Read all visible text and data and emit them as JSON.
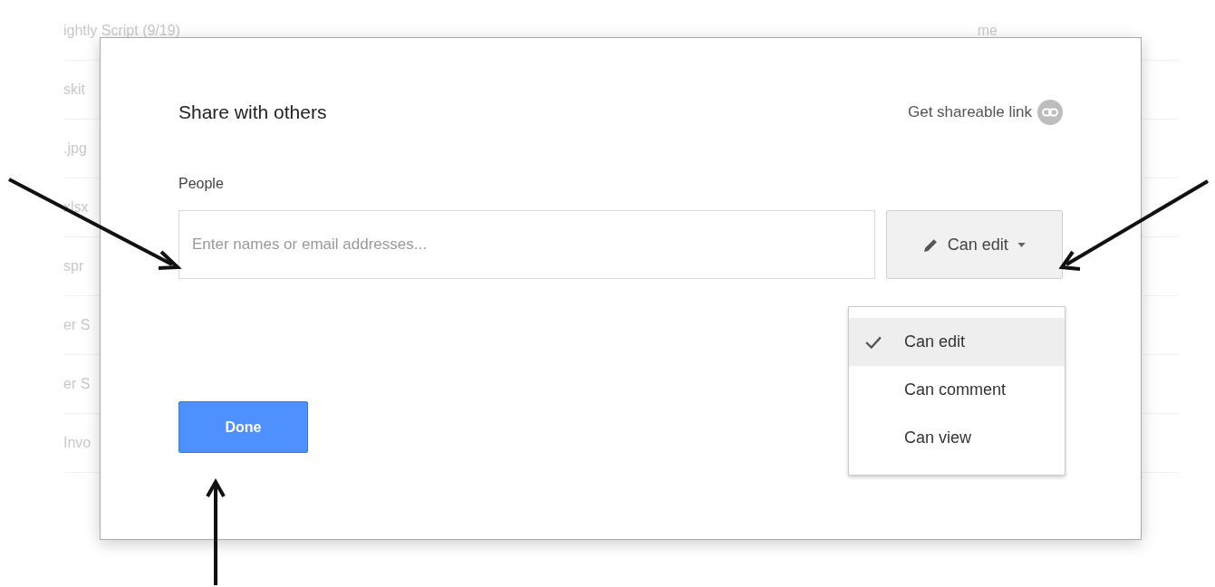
{
  "background_list": {
    "rows": [
      {
        "name": "ightly Script (9/19)",
        "owner": "me"
      },
      {
        "name": "skit"
      },
      {
        "name": ".jpg"
      },
      {
        "name": "xlsx"
      },
      {
        "name": "spr"
      },
      {
        "name": "er S"
      },
      {
        "name": "er S"
      },
      {
        "name": "Invo"
      }
    ]
  },
  "dialog": {
    "title": "Share with others",
    "link_label": "Get shareable link",
    "people_label": "People",
    "people_field": {
      "placeholder": "Enter names or email addresses..."
    },
    "permission_button": {
      "label": "Can edit"
    },
    "permission_menu": [
      {
        "label": "Can edit",
        "selected": true
      },
      {
        "label": "Can comment",
        "selected": false
      },
      {
        "label": "Can view",
        "selected": false
      }
    ],
    "done_button": "Done"
  }
}
